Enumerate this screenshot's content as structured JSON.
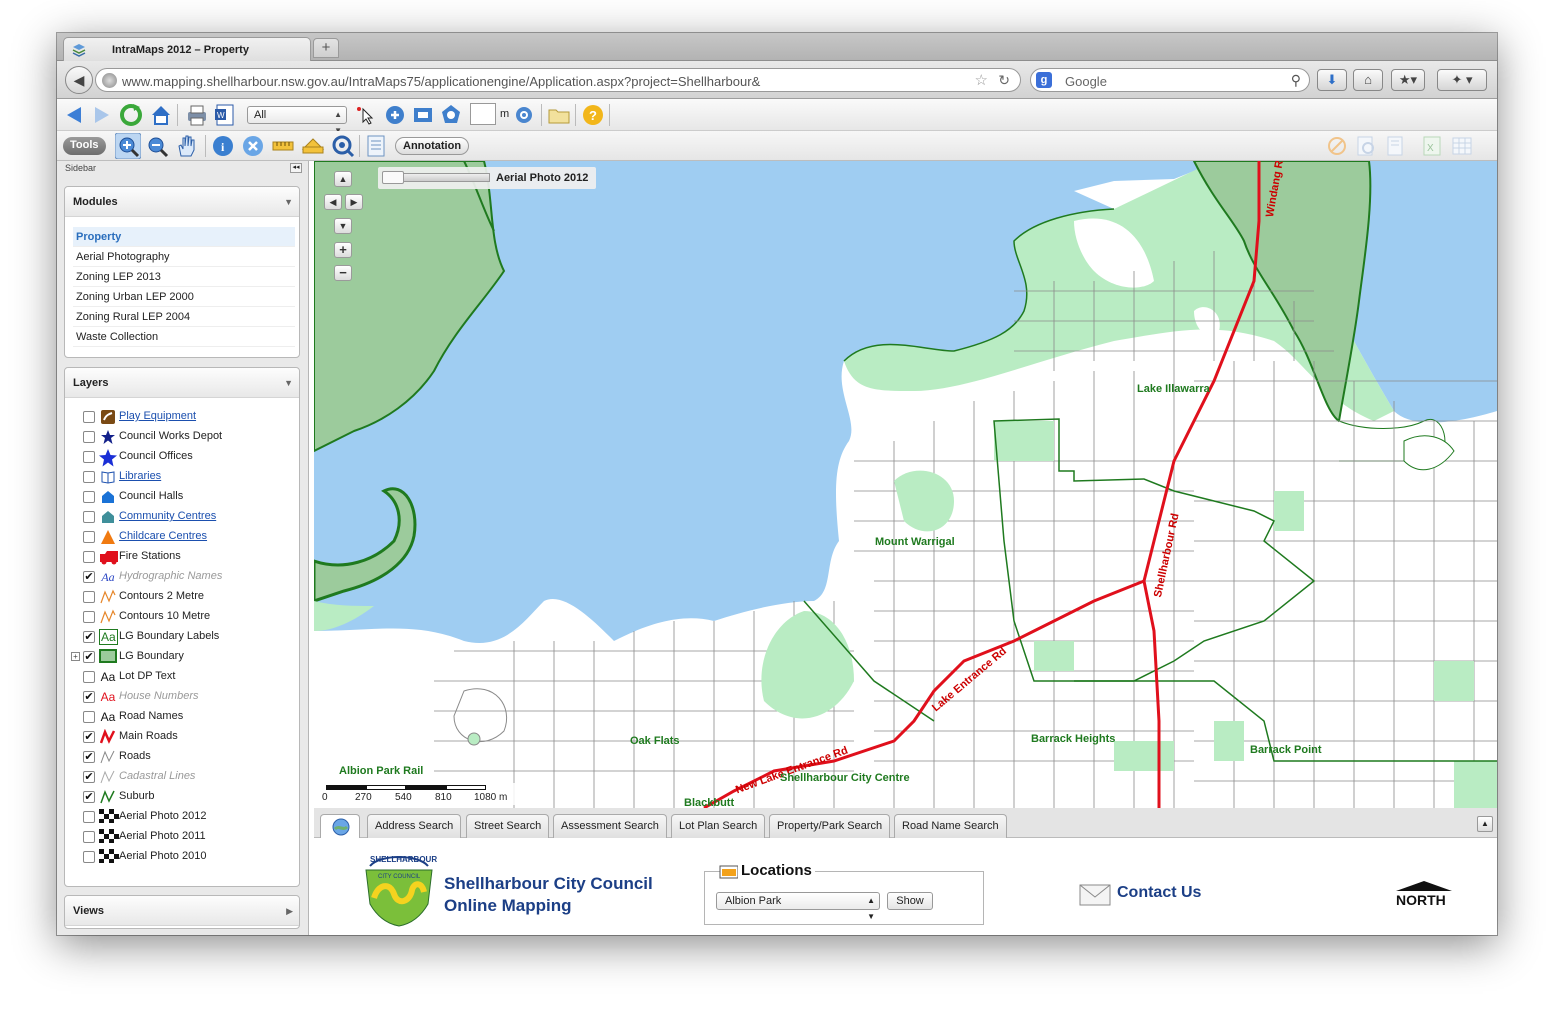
{
  "browser": {
    "tab_title": "IntraMaps 2012 – Property",
    "new_tab": "+",
    "url": "www.mapping.shellharbour.nsw.gov.au/IntraMaps75/applicationengine/Application.aspx?project=Shellharbour&",
    "search_placeholder": "Google"
  },
  "toolbar": {
    "select_value": "All",
    "scale_unit": "m",
    "tools_label": "Tools",
    "annotation_label": "Annotation"
  },
  "sidebar": {
    "header": "Sidebar",
    "modules_title": "Modules",
    "modules": [
      {
        "label": "Property"
      },
      {
        "label": "Aerial Photography"
      },
      {
        "label": "Zoning LEP 2013"
      },
      {
        "label": "Zoning Urban LEP 2000"
      },
      {
        "label": "Zoning Rural LEP 2004"
      },
      {
        "label": "Waste Collection"
      }
    ],
    "layers_title": "Layers",
    "layers": [
      {
        "label": "Play Equipment",
        "checked": false,
        "icon": "play-equipment-icon"
      },
      {
        "label": "Council Works Depot",
        "checked": false,
        "icon": "star-icon"
      },
      {
        "label": "Council Offices",
        "checked": false,
        "icon": "big-star-icon"
      },
      {
        "label": "Libraries",
        "checked": false,
        "icon": "book-icon"
      },
      {
        "label": "Council Halls",
        "checked": false,
        "icon": "hall-icon"
      },
      {
        "label": "Community Centres",
        "checked": false,
        "icon": "house-icon"
      },
      {
        "label": "Childcare Centres",
        "checked": false,
        "icon": "triangle-icon"
      },
      {
        "label": "Fire Stations",
        "checked": false,
        "icon": "fire-truck-icon"
      },
      {
        "label": "Hydrographic Names",
        "checked": true,
        "icon": "text-style-icon"
      },
      {
        "label": "Contours 2 Metre",
        "checked": false,
        "icon": "contour-icon"
      },
      {
        "label": "Contours 10 Metre",
        "checked": false,
        "icon": "contour-icon"
      },
      {
        "label": "LG Boundary Labels",
        "checked": true,
        "icon": "text-style-icon"
      },
      {
        "label": "LG Boundary",
        "checked": true,
        "icon": "boundary-icon"
      },
      {
        "label": "Lot DP Text",
        "checked": false,
        "icon": "text-style-icon"
      },
      {
        "label": "House Numbers",
        "checked": true,
        "icon": "text-style-icon"
      },
      {
        "label": "Road Names",
        "checked": false,
        "icon": "text-style-icon"
      },
      {
        "label": "Main Roads",
        "checked": true,
        "icon": "main-road-icon"
      },
      {
        "label": "Roads",
        "checked": true,
        "icon": "road-icon"
      },
      {
        "label": "Cadastral Lines",
        "checked": true,
        "icon": "cadastral-icon"
      },
      {
        "label": "Suburb",
        "checked": true,
        "icon": "suburb-icon"
      },
      {
        "label": "Aerial Photo 2012",
        "checked": false,
        "icon": "aerial-icon"
      },
      {
        "label": "Aerial Photo 2011",
        "checked": false,
        "icon": "aerial-icon"
      },
      {
        "label": "Aerial Photo 2010",
        "checked": false,
        "icon": "aerial-icon"
      }
    ],
    "views_title": "Views"
  },
  "map": {
    "opacity_label": "Aerial Photo 2012",
    "labels": {
      "windang_rd": "Windang Rd",
      "lake_illawarra": "Lake Illawarra",
      "shellharbour_rd": "Shellharbour Rd",
      "mount_warrigal": "Mount Warrigal",
      "lake_entrance_rd": "Lake Entrance Rd",
      "new_lake_entrance_rd": "New Lake Entrance Rd",
      "oak_flats": "Oak Flats",
      "barrack_heights": "Barrack Heights",
      "barrack_point": "Barrack Point",
      "albion_park_rail": "Albion Park Rail",
      "shellharbour_city_centre": "Shellharbour City Centre",
      "blackbutt": "Blackbutt"
    },
    "scale_ticks": [
      "0",
      "270",
      "540",
      "810",
      "1080 m"
    ]
  },
  "search_tabs": [
    "Address Search",
    "Street Search",
    "Assessment Search",
    "Lot Plan Search",
    "Property/Park Search",
    "Road Name Search"
  ],
  "footer": {
    "logo_text_top": "SHELLHARBOUR",
    "logo_text_bottom": "CITY COUNCIL",
    "council_line1": "Shellharbour City Council",
    "council_line2": "Online Mapping",
    "locations_title": "Locations",
    "location_value": "Albion Park",
    "show_button": "Show",
    "contact_us": "Contact Us",
    "north": "NORTH"
  },
  "colors": {
    "water": "#9fcdf2",
    "land": "#ffffff",
    "park": "#b9ecc3",
    "reserve": "#9ccb9c",
    "boundary": "#1f7a1f",
    "main_road": "#e0101c",
    "council_blue": "#1c3f86"
  }
}
